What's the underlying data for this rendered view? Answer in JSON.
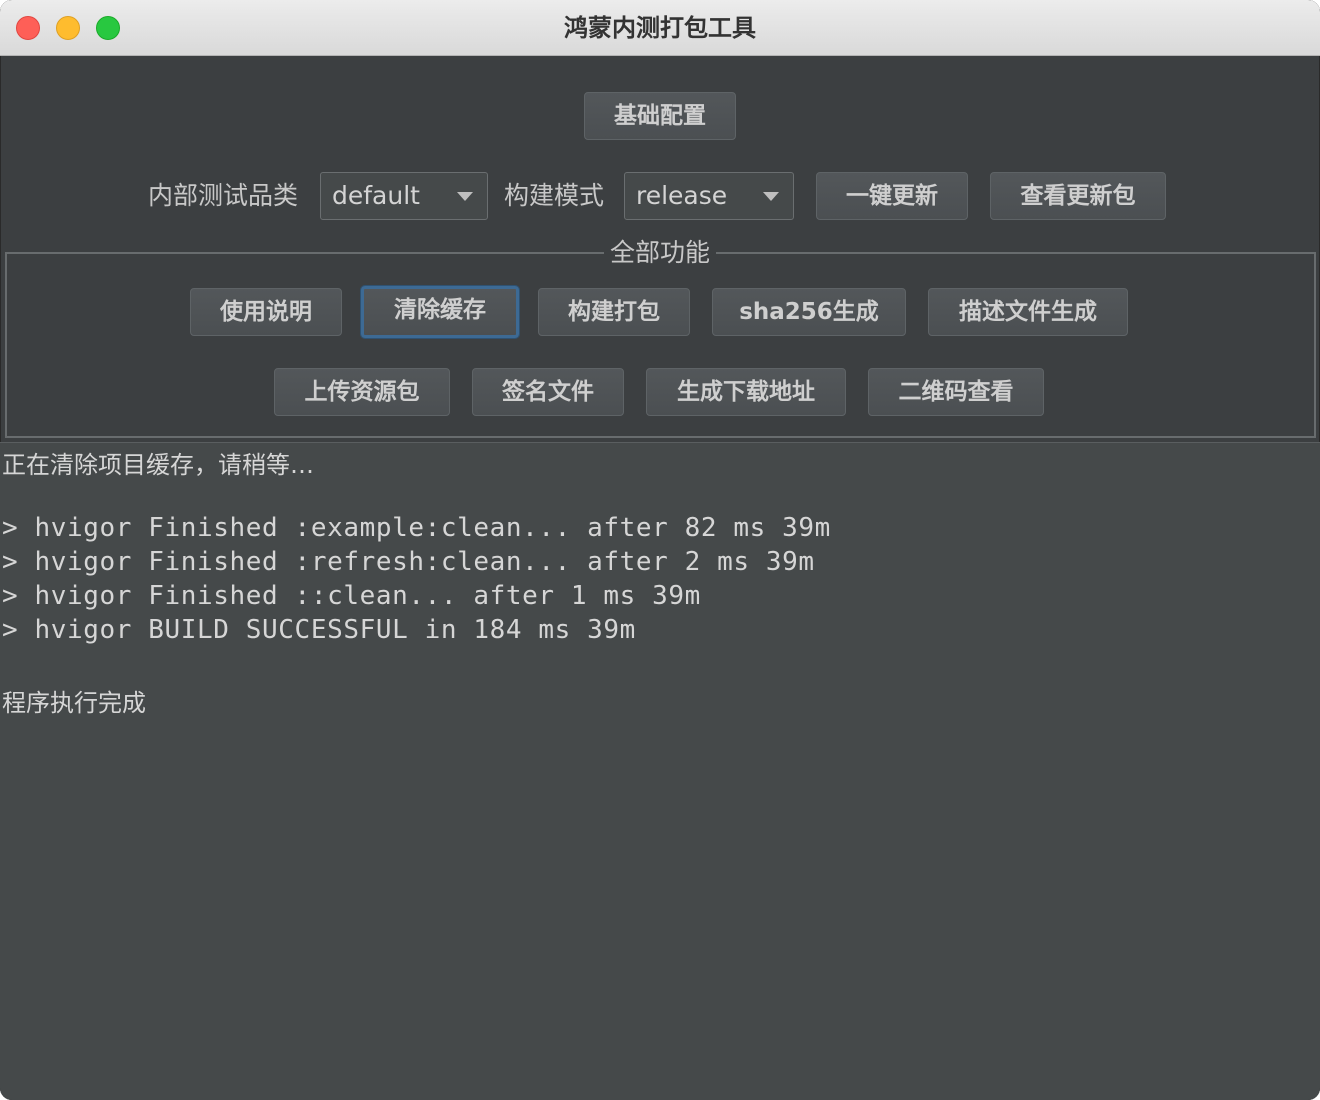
{
  "window": {
    "title": "鸿蒙内测打包工具"
  },
  "toolbar": {
    "basic_config_label": "基础配置",
    "category_label": "内部测试品类",
    "category_value": "default",
    "build_mode_label": "构建模式",
    "build_mode_value": "release",
    "one_click_update_label": "一键更新",
    "view_update_package_label": "查看更新包"
  },
  "features": {
    "title": "全部功能",
    "row1": [
      "使用说明",
      "清除缓存",
      "构建打包",
      "sha256生成",
      "描述文件生成"
    ],
    "row2": [
      "上传资源包",
      "签名文件",
      "生成下载地址",
      "二维码查看"
    ],
    "focused": "清除缓存"
  },
  "console": {
    "lines": [
      "正在清除项目缓存，请稍等…",
      "",
      "> hvigor Finished :example:clean... after 82 ms 39m",
      "> hvigor Finished :refresh:clean... after 2 ms 39m",
      "> hvigor Finished ::clean... after 1 ms 39m",
      "> hvigor BUILD SUCCESSFUL in 184 ms 39m",
      "",
      "程序执行完成"
    ]
  },
  "colors": {
    "window_bg": "#3c3f41",
    "console_bg": "#45494a",
    "focus_border": "#3d6a94"
  }
}
